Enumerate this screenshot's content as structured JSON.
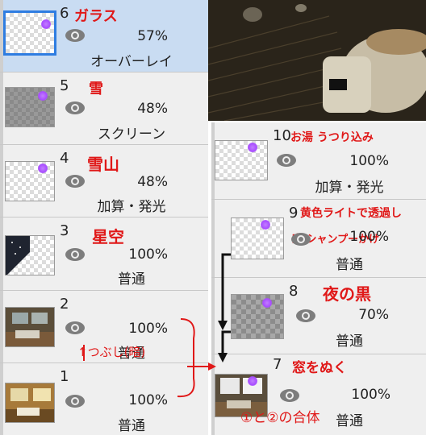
{
  "left_layers": [
    {
      "num": "6",
      "opacity": "57%",
      "mode": "オーバーレイ",
      "note": "ガラス",
      "selected": true
    },
    {
      "num": "5",
      "opacity": "48%",
      "mode": "スクリーン",
      "note": "雪"
    },
    {
      "num": "4",
      "opacity": "48%",
      "mode": "加算・発光",
      "note": "雪山"
    },
    {
      "num": "3",
      "opacity": "100%",
      "mode": "普通",
      "note": "星空"
    },
    {
      "num": "2",
      "opacity": "100%",
      "mode": "普通",
      "note": ""
    },
    {
      "num": "1",
      "opacity": "100%",
      "mode": "普通",
      "note": ""
    }
  ],
  "right_layers": [
    {
      "num": "10",
      "opacity": "100%",
      "mode": "加算・発光",
      "note": "お湯 うつり込み"
    },
    {
      "num": "9",
      "opacity": "100%",
      "mode": "普通",
      "note": "黄色ライトで透過し",
      "note2": "窓 シャンプーかけ"
    },
    {
      "num": "8",
      "opacity": "70%",
      "mode": "普通",
      "note": "夜の黒"
    },
    {
      "num": "7",
      "opacity": "100%",
      "mode": "普通",
      "note": "窓をぬく"
    }
  ],
  "annotations": {
    "arrow_note": "↑つぶし(暗)",
    "bottom_note": "①と②の合体",
    "eye_icon": "eye-icon"
  }
}
